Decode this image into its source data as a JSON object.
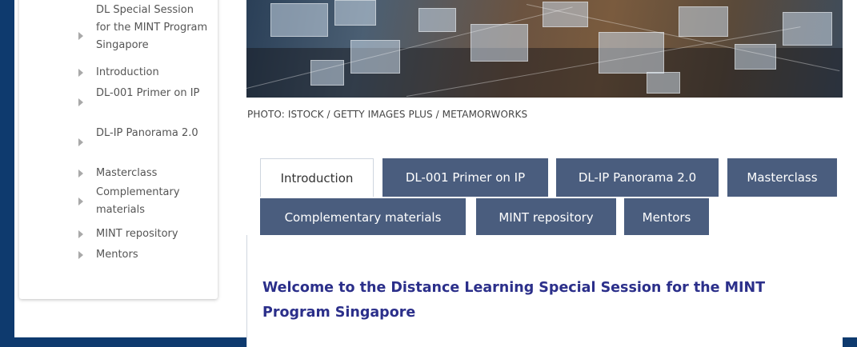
{
  "sidebar": {
    "items": [
      {
        "label": "DL Special Session for the MINT Program Singapore",
        "has_arrow": true
      },
      {
        "label": "Introduction"
      },
      {
        "label": "DL-001 Primer on IP"
      },
      {
        "label": "DL-IP Panorama 2.0"
      },
      {
        "label": "Masterclass"
      },
      {
        "label": "Complementary materials"
      },
      {
        "label": "MINT repository"
      },
      {
        "label": "Mentors"
      }
    ]
  },
  "banner": {
    "caption": "PHOTO: ISTOCK / GETTY IMAGES PLUS / METAMORWORKS"
  },
  "tabs": [
    {
      "label": "Introduction",
      "active": true
    },
    {
      "label": "DL-001 Primer on IP",
      "active": false
    },
    {
      "label": "DL-IP Panorama 2.0",
      "active": false
    },
    {
      "label": "Masterclass",
      "active": false
    },
    {
      "label": "Complementary materials",
      "active": false
    },
    {
      "label": "MINT repository",
      "active": false
    },
    {
      "label": "Mentors",
      "active": false
    }
  ],
  "content": {
    "heading": "Welcome to the Distance Learning Special Session for the MINT Program Singapore"
  },
  "colors": {
    "background": "#0e3a6e",
    "tab_inactive": "#4a5d7e",
    "heading": "#2b2f8a"
  }
}
